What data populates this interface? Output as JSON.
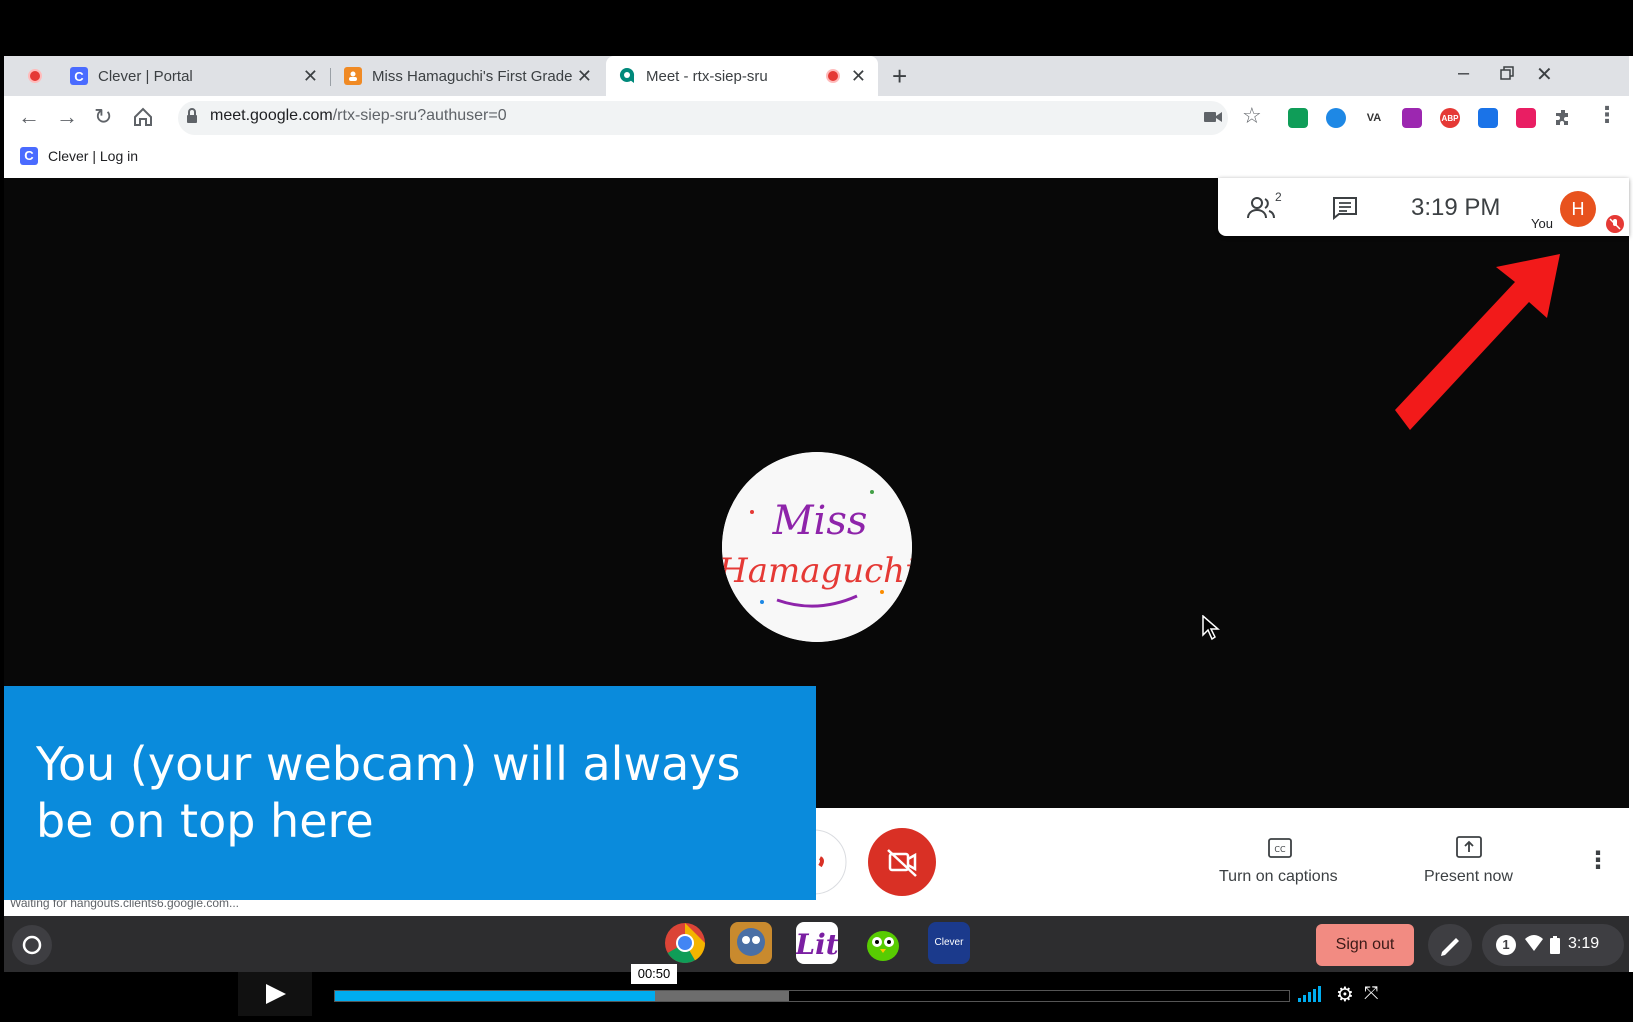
{
  "browser": {
    "tabs": [
      {
        "title": "Clever | Portal",
        "favicon": "C",
        "favicon_color": "#4a6bff",
        "recording": true
      },
      {
        "title": "Miss Hamaguchi's First Grade",
        "favicon": "",
        "favicon_color": "#f08a24",
        "recording": false
      },
      {
        "title": "Meet - rtx-siep-sru",
        "favicon": "",
        "favicon_color": "#00897b",
        "recording": true,
        "active": true
      }
    ],
    "url_host": "meet.google.com",
    "url_path": "/rtx-siep-sru?authuser=0",
    "bookmark": {
      "label": "Clever | Log in",
      "favicon": "C"
    },
    "extensions": [
      {
        "icon": "",
        "color": "#0f9d58"
      },
      {
        "icon": "",
        "color": "#1e88e5"
      },
      {
        "icon": "VA",
        "color": "#ffffff"
      },
      {
        "icon": "",
        "color": "#9c27b0"
      },
      {
        "icon": "ABP",
        "color": "#e53935"
      },
      {
        "icon": "",
        "color": "#1a73e8"
      },
      {
        "icon": "",
        "color": "#e91e63"
      },
      {
        "icon": "",
        "color": "#5f6368"
      }
    ]
  },
  "meet": {
    "participants_count": "2",
    "time": "3:19 PM",
    "avatar_letter": "H",
    "you_label": "You",
    "logo_line1": "Miss",
    "logo_line2": "Hamaguchi",
    "captions_label": "Turn on captions",
    "captions_icon": "CC",
    "present_label": "Present now"
  },
  "caption_overlay": {
    "text": "You (your webcam) will always be on top here"
  },
  "status_text": "Waiting for hangouts.clients6.google.com...",
  "shelf": {
    "sign_out": "Sign out",
    "tray_time": "3:19",
    "notification_count": "1",
    "clever_app_label": "Clever"
  },
  "player": {
    "time_tooltip": "00:50",
    "progress": 0.335,
    "buffered": 0.476
  },
  "colors": {
    "caption_blue": "#0a8bdc",
    "hangup_red": "#d93025",
    "arrow_red": "#f21a1a",
    "progress_blue": "#00adef"
  }
}
